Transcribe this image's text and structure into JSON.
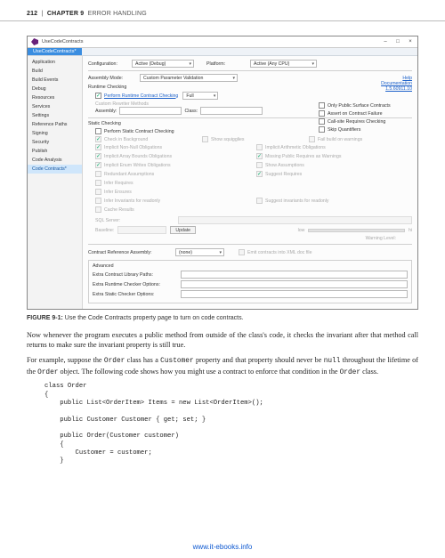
{
  "header": {
    "page_number": "212",
    "chapter_label": "CHAPTER 9",
    "chapter_title": "ERROR HANDLING"
  },
  "figure": {
    "caption_label": "FIGURE 9-1:",
    "caption_text": "Use the Code Contracts property page to turn on code contracts."
  },
  "vs": {
    "title": "UseCodeContracts",
    "tab": "UseCodeContracts*",
    "sidebar": [
      "Application",
      "Build",
      "Build Events",
      "Debug",
      "Resources",
      "Services",
      "Settings",
      "Reference Paths",
      "Signing",
      "Security",
      "Publish",
      "Code Analysis",
      "Code Contracts*"
    ],
    "config_label": "Configuration:",
    "config_value": "Active (Debug)",
    "platform_label": "Platform:",
    "platform_value": "Active (Any CPU)",
    "help_link": "Help",
    "doc_link": "Documentation",
    "version": "1.5.60911.10",
    "assembly_mode_label": "Assembly Mode:",
    "assembly_mode_value": "Custom Parameter Validation",
    "runtime_section": "Runtime Checking",
    "perform_runtime": "Perform Runtime Contract Checking",
    "runtime_level": "Full",
    "custom_rewriter": "Custom Rewriter Methods",
    "assembly_label": "Assembly:",
    "class_label": "Class:",
    "rt_opts": [
      "Only Public Surface Contracts",
      "Assert on Contract Failure",
      "Call-site Requires Checking",
      "Skip Quantifiers"
    ],
    "static_section": "Static Checking",
    "perform_static": "Perform Static Contract Checking",
    "static_row1": [
      "Check in Background",
      "Show squigglies",
      "Fail build on warnings"
    ],
    "static_opts": [
      "Implicit Non-Null Obligations",
      "Implicit Arithmetic Obligations",
      "Implicit Array Bounds Obligations",
      "Missing Public Requires as Warnings",
      "Implicit Enum Writes Obligations",
      "Show Assumptions",
      "Redundant Assumptions",
      "Suggest Requires",
      "Infer Requires",
      "",
      "Infer Ensures",
      "",
      "Infer Invariants for readonly",
      "Suggest invariants for readonly",
      "Cache Results",
      ""
    ],
    "sql_server_label": "SQL Server:",
    "warning_level_label": "Warning Level:",
    "wl_low": "low",
    "wl_hi": "hi",
    "baseline_label": "Baseline:",
    "update_btn": "Update",
    "contract_ref_label": "Contract Reference Assembly:",
    "contract_ref_value": "(none)",
    "emit_xml": "Emit contracts into XML doc file",
    "advanced_label": "Advanced",
    "extra_lib": "Extra Contract Library Paths:",
    "extra_runtime": "Extra Runtime Checker Options:",
    "extra_static": "Extra Static Checker Options:"
  },
  "body": {
    "p1": "Now whenever the program executes a public method from outside of the class's code, it checks the invariant after that method call returns to make sure the invariant property is still true.",
    "p2a": "For example, suppose the ",
    "p2_c1": "Order",
    "p2b": " class has a ",
    "p2_c2": "Customer",
    "p2c": " property and that property should never be ",
    "p2_c3": "null",
    "p2d": " throughout the lifetime of the ",
    "p2_c4": "Order",
    "p2e": " object. The following code shows how you might use a contract to enforce that condition in the ",
    "p2_c5": "Order",
    "p2f": " class."
  },
  "code": "class Order\n{\n    public List<OrderItem> Items = new List<OrderItem>();\n\n    public Customer Customer { get; set; }\n\n    public Order(Customer customer)\n    {\n        Customer = customer;\n    }",
  "footer": {
    "url": "www.it-ebooks.info"
  }
}
